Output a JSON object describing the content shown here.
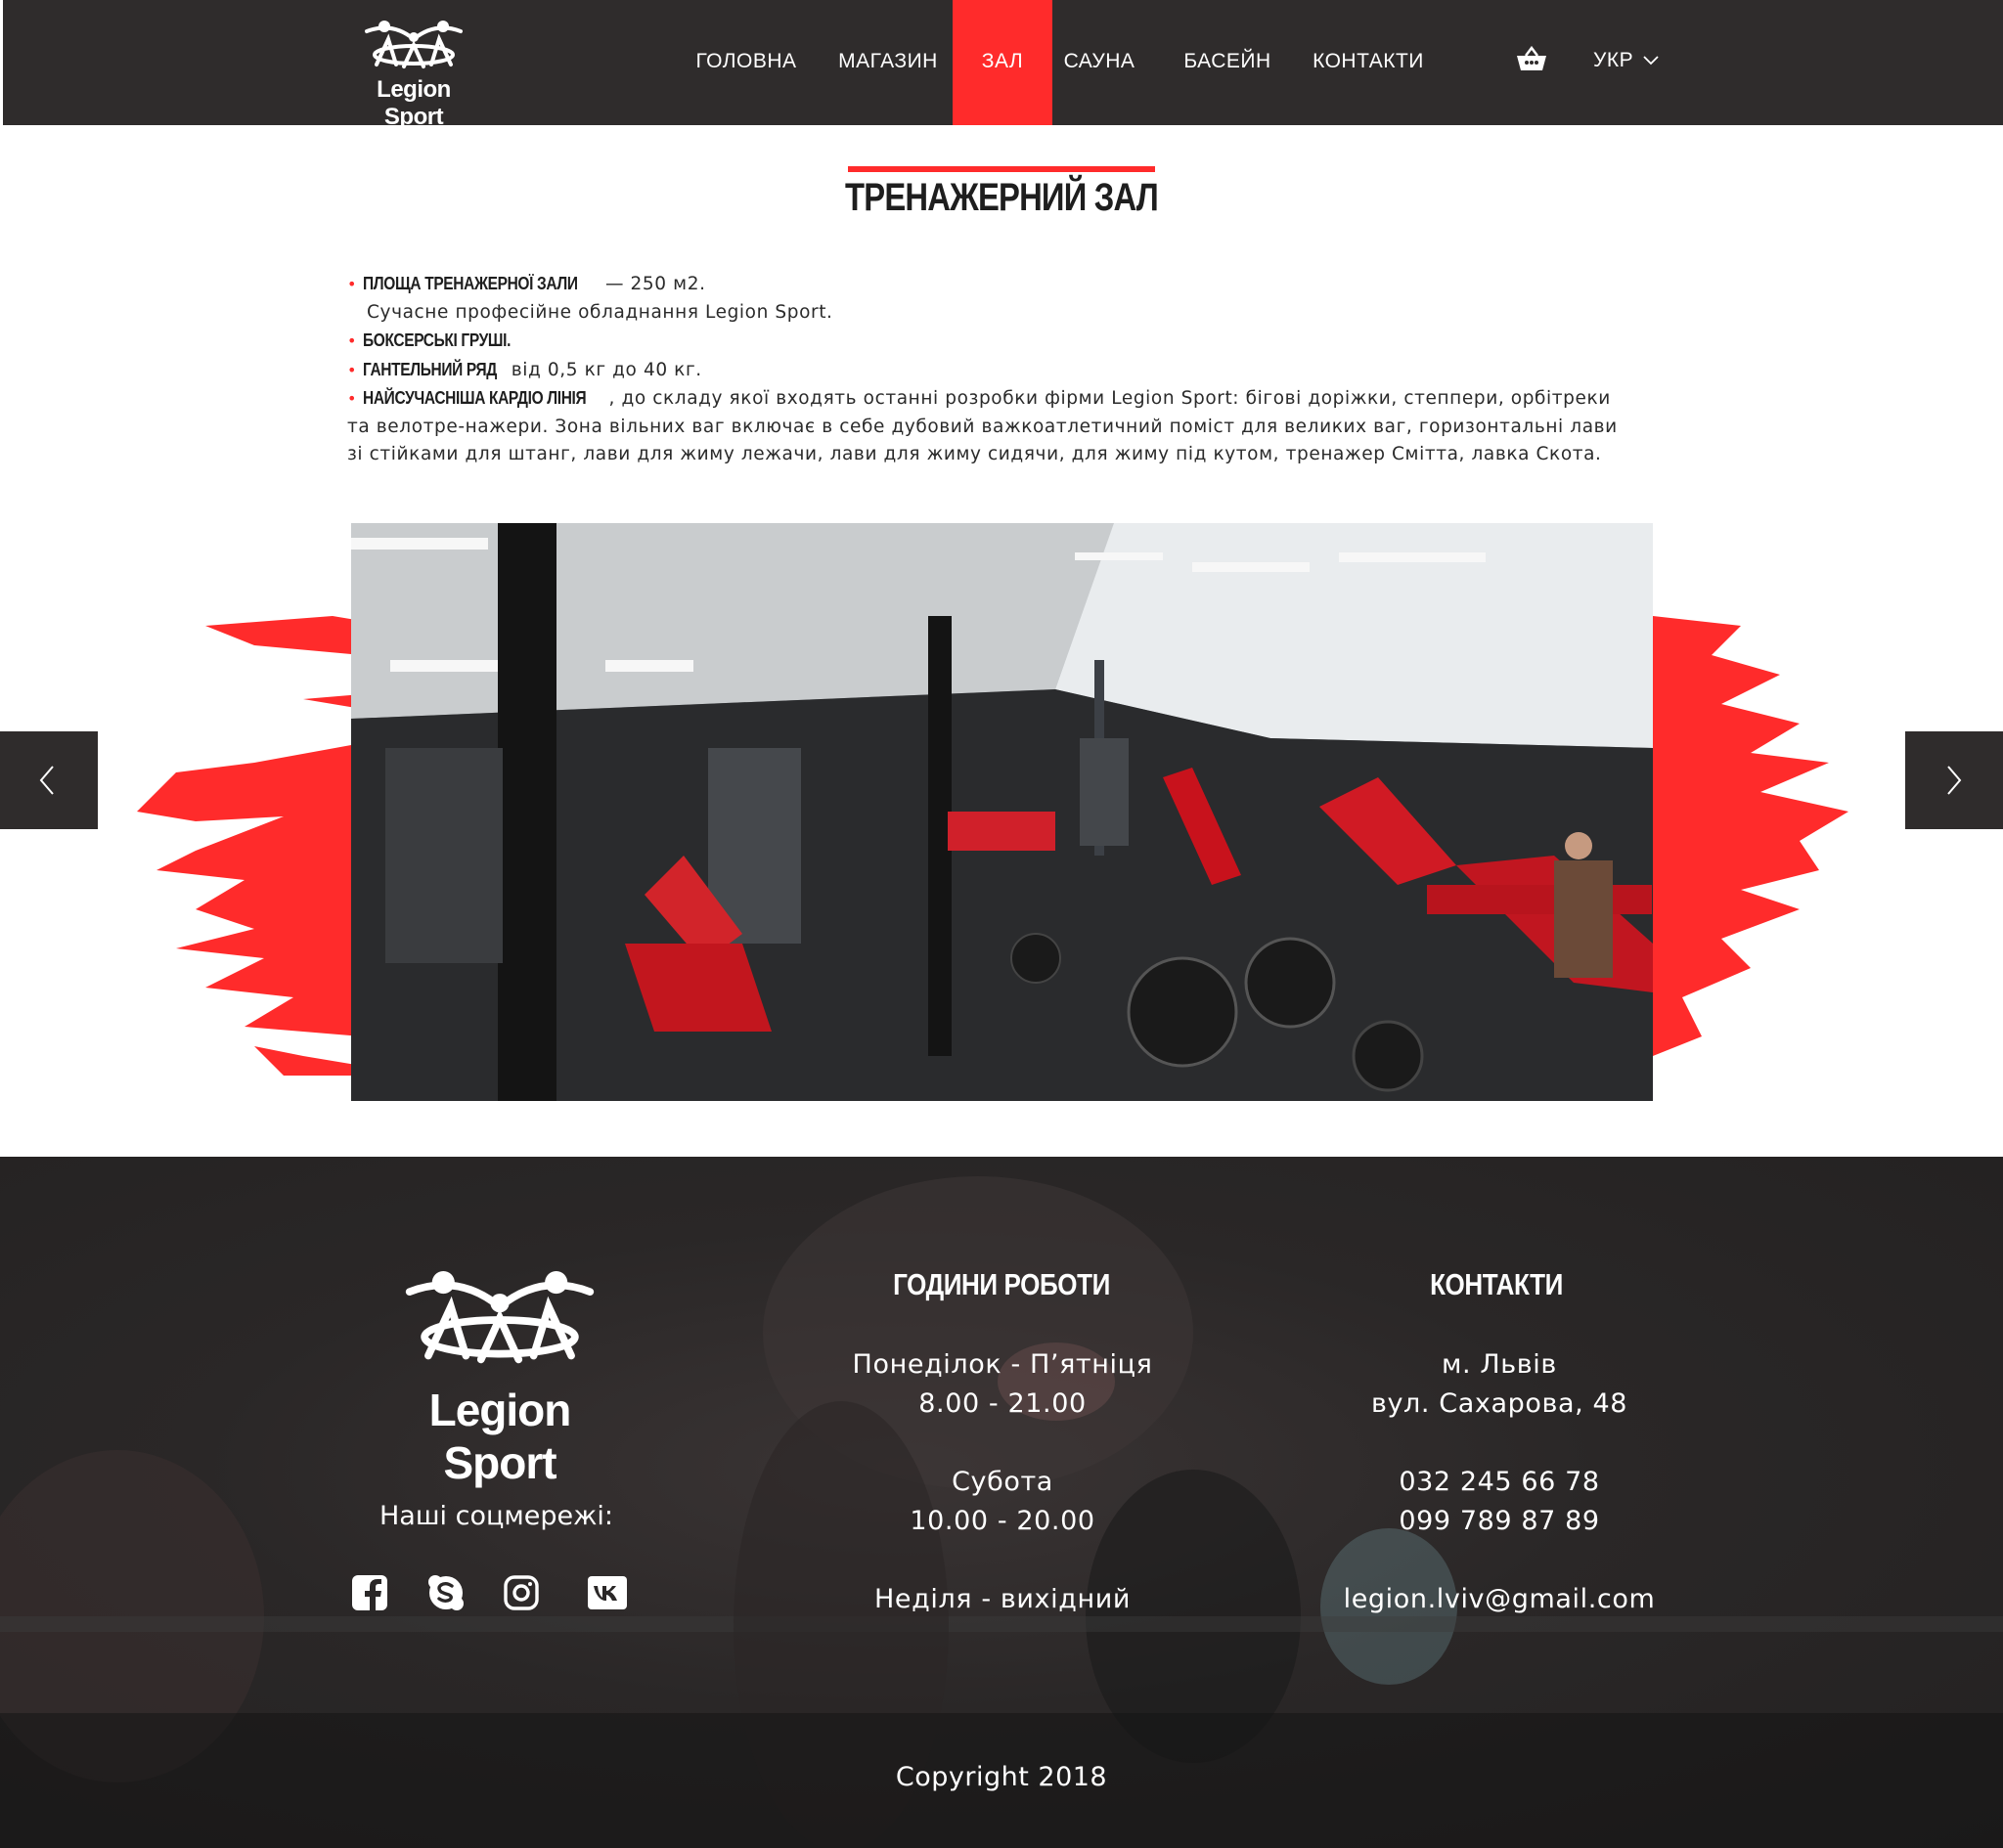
{
  "header": {
    "logo_text": "Legion Sport",
    "nav": [
      {
        "label": "ГОЛОВНА"
      },
      {
        "label": "МАГАЗИН"
      },
      {
        "label": "ЗАЛ"
      },
      {
        "label": "САУНА"
      },
      {
        "label": "БАСЕЙН"
      },
      {
        "label": "КОНТАКТИ"
      }
    ],
    "active_nav": "ЗАЛ",
    "cart_icon": "shopping-basket-icon",
    "language": "УКР"
  },
  "main": {
    "title": "ТРЕНАЖЕРНИЙ ЗАЛ",
    "items": [
      {
        "label": "ПЛОЩА ТРЕНАЖЕРНОЇ ЗАЛИ",
        "text": " — 250 м2."
      },
      {
        "label": "",
        "text": "Сучасне професійне обладнання Legion Sport."
      },
      {
        "label": "БОКСЕРСЬКІ ГРУШІ.",
        "text": ""
      },
      {
        "label": "ГАНТЕЛЬНИЙ РЯД",
        "text": " від 0,5 кг до 40 кг."
      },
      {
        "label": "НАЙСУЧАСНІША КАРДІО ЛІНІЯ",
        "text": ", до складу якої входять останні розробки фірми Legion Sport: бігові доріжки, степпери, орбітреки та велотре-нажери. Зона вільних ваг включає в себе дубовий важкоатлетичний поміст для великих ваг, горизонтальні лави зі стійками для штанг, лави для жиму лежачи, лави для жиму сидячи, для жиму під кутом, тренажер Смітта, лавка Скота."
      }
    ],
    "gallery": {
      "prev_icon": "chevron-left-icon",
      "next_icon": "chevron-right-icon"
    }
  },
  "footer": {
    "logo_text": "Legion Sport",
    "social_label": "Наші соцмережі:",
    "social": [
      "facebook-icon",
      "skype-icon",
      "instagram-icon",
      "vk-icon"
    ],
    "hours": {
      "title": "ГОДИНИ РОБОТИ",
      "lines": [
        "Понеділок - П’ятніця",
        "8.00 - 21.00",
        "Субота",
        "10.00 - 20.00",
        "Неділя - вихідний"
      ]
    },
    "contacts": {
      "title": "КОНТАКТИ",
      "lines": [
        "м. Львів",
        "вул. Сахарова, 48",
        "032 245 66 78",
        "099 789 87 89",
        "legion.lviv@gmail.com"
      ]
    },
    "copyright": "Copyright 2018"
  },
  "colors": {
    "accent": "#ff2b2b",
    "header_bg": "#2f2c2c",
    "footer_bg": "#2a2727"
  }
}
